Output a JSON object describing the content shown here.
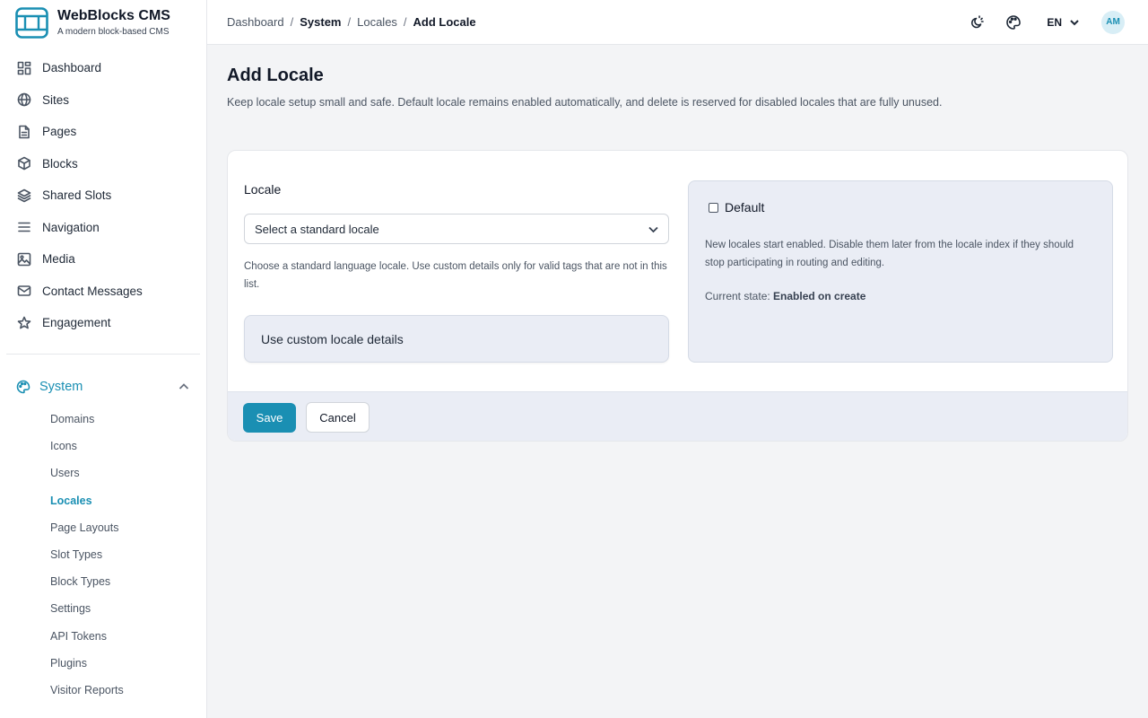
{
  "brand": {
    "name": "WebBlocks CMS",
    "tagline": "A modern block-based CMS"
  },
  "sidebar": {
    "items": [
      {
        "label": "Dashboard",
        "icon": "dashboard-icon"
      },
      {
        "label": "Sites",
        "icon": "globe-icon"
      },
      {
        "label": "Pages",
        "icon": "document-icon"
      },
      {
        "label": "Blocks",
        "icon": "cube-icon"
      },
      {
        "label": "Shared Slots",
        "icon": "layers-icon"
      },
      {
        "label": "Navigation",
        "icon": "menu-icon"
      },
      {
        "label": "Media",
        "icon": "image-icon"
      },
      {
        "label": "Contact Messages",
        "icon": "mail-icon"
      },
      {
        "label": "Engagement",
        "icon": "star-icon"
      }
    ],
    "system": {
      "label": "System",
      "expanded": true,
      "items": [
        "Domains",
        "Icons",
        "Users",
        "Locales",
        "Page Layouts",
        "Slot Types",
        "Block Types",
        "Settings",
        "API Tokens",
        "Plugins",
        "Visitor Reports"
      ],
      "active": "Locales"
    }
  },
  "header": {
    "breadcrumbs": [
      "Dashboard",
      "System",
      "Locales",
      "Add Locale"
    ],
    "language": "EN",
    "avatar_initials": "AM"
  },
  "page": {
    "title": "Add Locale",
    "description": "Keep locale setup small and safe. Default locale remains enabled automatically, and delete is reserved for disabled locales that are fully unused."
  },
  "form": {
    "locale_label": "Locale",
    "select_placeholder": "Select a standard locale",
    "help_text": "Choose a standard language locale. Use custom details only for valid tags that are not in this list.",
    "custom_toggle": "Use custom locale details",
    "default_label": "Default",
    "default_checked": false,
    "panel_text": "New locales start enabled. Disable them later from the locale index if they should stop participating in routing and editing.",
    "current_state_label": "Current state:",
    "current_state_value": "Enabled on create",
    "save_label": "Save",
    "cancel_label": "Cancel"
  },
  "colors": {
    "accent": "#1a8fb3",
    "panel_bg": "#eaedf5",
    "page_bg": "#f3f4f6"
  }
}
